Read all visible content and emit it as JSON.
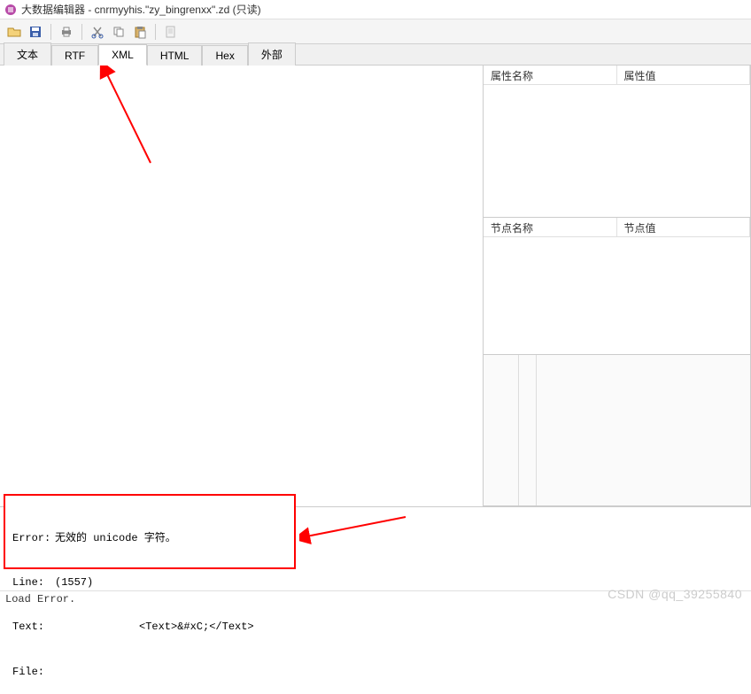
{
  "window": {
    "title": "大数据编辑器 - cnrmyyhis.\"zy_bingrenxx\".zd (只读)"
  },
  "toolbar": {
    "open": "open-icon",
    "save": "save-icon",
    "print": "print-icon",
    "cut": "cut-icon",
    "copy": "copy-icon",
    "paste": "paste-icon",
    "doc": "doc-icon"
  },
  "tabs": {
    "items": [
      "文本",
      "RTF",
      "XML",
      "HTML",
      "Hex",
      "外部"
    ],
    "active_index": 2
  },
  "right": {
    "props": {
      "col1": "属性名称",
      "col2": "属性值"
    },
    "nodes": {
      "col1": "节点名称",
      "col2": "节点值"
    }
  },
  "error": {
    "label_error": "Error:",
    "msg_error": "无效的 unicode 字符。",
    "label_line": "Line:",
    "msg_line": "(1557)",
    "label_text": "Text:",
    "msg_text": "<Text>&#xC;</Text>",
    "label_file": "File:",
    "msg_file": ""
  },
  "status": {
    "text": "Load Error."
  },
  "watermark": "CSDN @qq_39255840"
}
